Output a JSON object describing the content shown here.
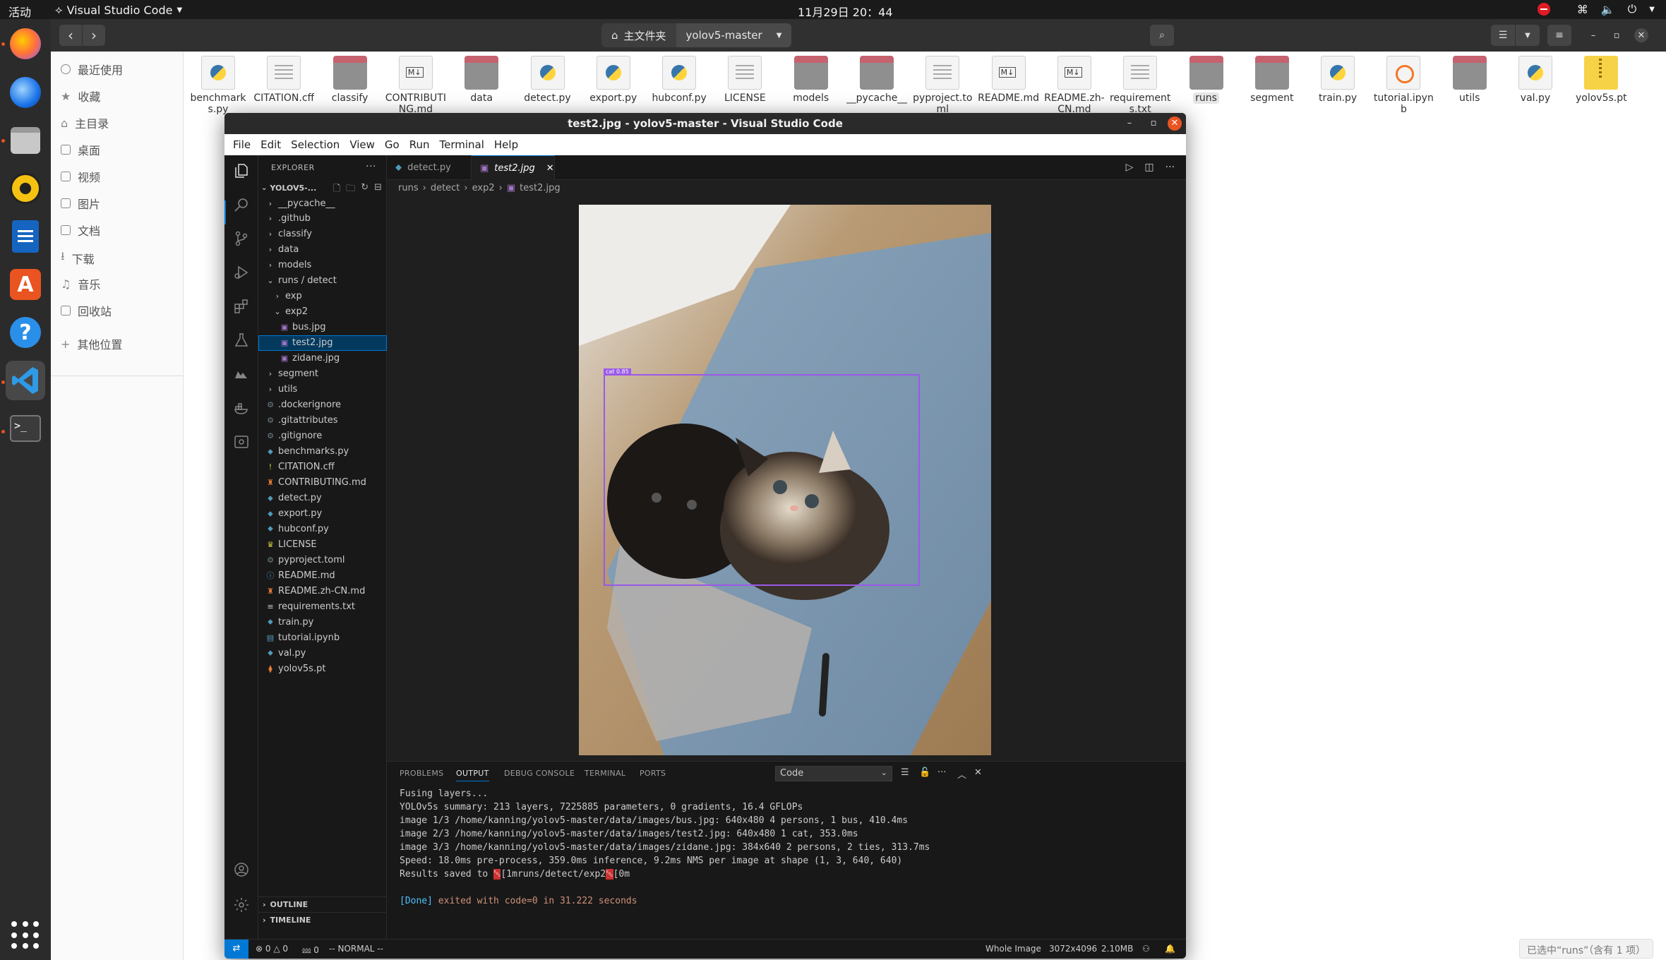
{
  "topbar": {
    "activities": "活动",
    "app_name": "Visual Studio Code",
    "clock": "11月29日  20：44"
  },
  "dock": {
    "items": [
      "firefox-icon",
      "thunderbird-icon",
      "files-icon",
      "rhythmbox-icon",
      "libreoffice-writer-icon",
      "app-center-icon",
      "help-icon",
      "vscode-icon",
      "terminal-icon"
    ],
    "show_apps": "show-apps-icon"
  },
  "file_manager": {
    "path": {
      "home": "主文件夹",
      "current": "yolov5-master"
    },
    "sidebar": [
      "最近使用",
      "收藏",
      "主目录",
      "桌面",
      "视频",
      "图片",
      "文档",
      "下载",
      "音乐",
      "回收站"
    ],
    "other_locations": "其他位置",
    "files": [
      {
        "name": "benchmarks.py",
        "kind": "py"
      },
      {
        "name": "CITATION.cff",
        "kind": "doc"
      },
      {
        "name": "classify",
        "kind": "folder"
      },
      {
        "name": "CONTRIBUTING.md",
        "kind": "md"
      },
      {
        "name": "data",
        "kind": "folder"
      },
      {
        "name": "detect.py",
        "kind": "py"
      },
      {
        "name": "export.py",
        "kind": "py"
      },
      {
        "name": "hubconf.py",
        "kind": "py"
      },
      {
        "name": "LICENSE",
        "kind": "doc"
      },
      {
        "name": "models",
        "kind": "folder"
      },
      {
        "name": "__pycache__",
        "kind": "folder"
      },
      {
        "name": "pyproject.toml",
        "kind": "doc"
      },
      {
        "name": "README.md",
        "kind": "md"
      },
      {
        "name": "README.zh-CN.md",
        "kind": "md"
      },
      {
        "name": "requirements.txt",
        "kind": "doc"
      },
      {
        "name": "runs",
        "kind": "folder",
        "selected": true
      },
      {
        "name": "segment",
        "kind": "folder"
      },
      {
        "name": "train.py",
        "kind": "py"
      },
      {
        "name": "tutorial.ipynb",
        "kind": "nb"
      },
      {
        "name": "utils",
        "kind": "folder"
      },
      {
        "name": "val.py",
        "kind": "py"
      },
      {
        "name": "yolov5s.pt",
        "kind": "zip"
      }
    ],
    "status": "已选中“runs”（含有 1 项）"
  },
  "vscode": {
    "title": "test2.jpg - yolov5-master - Visual Studio Code",
    "menu": [
      "File",
      "Edit",
      "Selection",
      "View",
      "Go",
      "Run",
      "Terminal",
      "Help"
    ],
    "explorer": {
      "header": "EXPLORER",
      "more": "···",
      "project": "YOLOV5-...",
      "tree": [
        {
          "label": "__pycache__",
          "type": "folder",
          "depth": 1
        },
        {
          "label": ".github",
          "type": "folder",
          "depth": 1
        },
        {
          "label": "classify",
          "type": "folder",
          "depth": 1
        },
        {
          "label": "data",
          "type": "folder",
          "depth": 1
        },
        {
          "label": "models",
          "type": "folder",
          "depth": 1
        },
        {
          "label": "runs / detect",
          "type": "folder-open",
          "depth": 1
        },
        {
          "label": "exp",
          "type": "folder",
          "depth": 2
        },
        {
          "label": "exp2",
          "type": "folder-open",
          "depth": 2
        },
        {
          "label": "bus.jpg",
          "type": "img",
          "depth": 3
        },
        {
          "label": "test2.jpg",
          "type": "img",
          "depth": 3,
          "selected": true
        },
        {
          "label": "zidane.jpg",
          "type": "img",
          "depth": 3
        },
        {
          "label": "segment",
          "type": "folder",
          "depth": 1
        },
        {
          "label": "utils",
          "type": "folder",
          "depth": 1
        },
        {
          "label": ".dockerignore",
          "type": "file-cfg",
          "depth": 1
        },
        {
          "label": ".gitattributes",
          "type": "file-cfg",
          "depth": 1
        },
        {
          "label": ".gitignore",
          "type": "file-cfg",
          "depth": 1
        },
        {
          "label": "benchmarks.py",
          "type": "file-py",
          "depth": 1
        },
        {
          "label": "CITATION.cff",
          "type": "file-excl",
          "depth": 1
        },
        {
          "label": "CONTRIBUTING.md",
          "type": "file-md",
          "depth": 1
        },
        {
          "label": "detect.py",
          "type": "file-py",
          "depth": 1
        },
        {
          "label": "export.py",
          "type": "file-py",
          "depth": 1
        },
        {
          "label": "hubconf.py",
          "type": "file-py",
          "depth": 1
        },
        {
          "label": "LICENSE",
          "type": "file-lic",
          "depth": 1
        },
        {
          "label": "pyproject.toml",
          "type": "file-cfg",
          "depth": 1
        },
        {
          "label": "README.md",
          "type": "file-info",
          "depth": 1
        },
        {
          "label": "README.zh-CN.md",
          "type": "file-md",
          "depth": 1
        },
        {
          "label": "requirements.txt",
          "type": "file-txt",
          "depth": 1
        },
        {
          "label": "train.py",
          "type": "file-py",
          "depth": 1
        },
        {
          "label": "tutorial.ipynb",
          "type": "file-nb",
          "depth": 1
        },
        {
          "label": "val.py",
          "type": "file-py",
          "depth": 1
        },
        {
          "label": "yolov5s.pt",
          "type": "file-pt",
          "depth": 1
        }
      ],
      "outline": "OUTLINE",
      "timeline": "TIMELINE"
    },
    "tabs": [
      {
        "label": "detect.py",
        "active": false
      },
      {
        "label": "test2.jpg",
        "active": true
      }
    ],
    "breadcrumb": [
      "runs",
      "detect",
      "exp2",
      "test2.jpg"
    ],
    "detection": {
      "label": "cat 0.85",
      "color": "#9b59e8"
    },
    "panel": {
      "tabs": [
        "PROBLEMS",
        "OUTPUT",
        "DEBUG CONSOLE",
        "TERMINAL",
        "PORTS"
      ],
      "active_tab": "OUTPUT",
      "channel": "Code",
      "lines": [
        "Fusing layers...",
        "YOLOv5s summary: 213 layers, 7225885 parameters, 0 gradients, 16.4 GFLOPs",
        "image 1/3 /home/kanning/yolov5-master/data/images/bus.jpg: 640x480 4 persons, 1 bus, 410.4ms",
        "image 2/3 /home/kanning/yolov5-master/data/images/test2.jpg: 640x480 1 cat, 353.0ms",
        "image 3/3 /home/kanning/yolov5-master/data/images/zidane.jpg: 384x640 2 persons, 2 ties, 313.7ms",
        "Speed: 18.0ms pre-process, 359.0ms inference, 9.2ms NMS per image at shape (1, 3, 640, 640)"
      ],
      "results_prefix": "Results saved to ",
      "results_esc1": "␛",
      "results_mid": "[1mruns/detect/exp2",
      "results_esc2": "␛",
      "results_suffix": "[0m",
      "done_tag": "[Done]",
      "done_rest": " exited with code=0 in 31.222 seconds"
    },
    "status": {
      "errors": "0",
      "warnings": "0",
      "ports": "0",
      "mode": "-- NORMAL --",
      "zoom": "Whole Image",
      "dimensions": "3072x4096",
      "size": "2.10MB"
    }
  }
}
